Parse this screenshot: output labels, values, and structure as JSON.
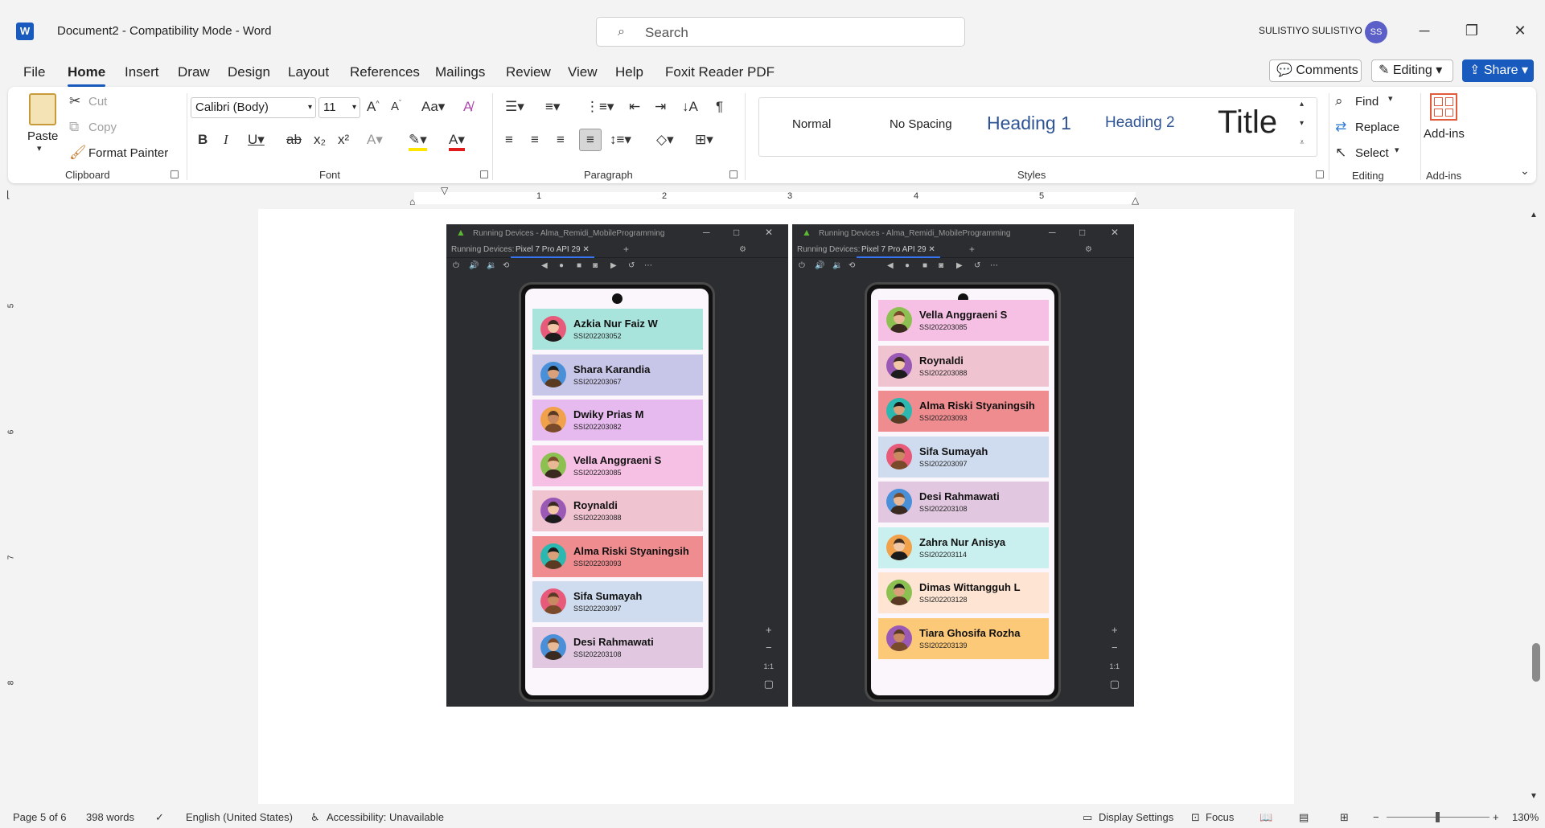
{
  "titlebar": {
    "app_icon": "word-logo-icon",
    "title": "Document2  -  Compatibility Mode  -  Word",
    "search_placeholder": "Search",
    "user": "SULISTIYO SULISTIYO",
    "avatar_initials": "SS"
  },
  "tabs": [
    "File",
    "Home",
    "Insert",
    "Draw",
    "Design",
    "Layout",
    "References",
    "Mailings",
    "Review",
    "View",
    "Help",
    "Foxit Reader PDF"
  ],
  "actions": {
    "comments": "Comments",
    "editing": "Editing",
    "share": "Share"
  },
  "clipboard": {
    "paste": "Paste",
    "cut": "Cut",
    "copy": "Copy",
    "format_painter": "Format Painter",
    "label": "Clipboard"
  },
  "font": {
    "name": "Calibri (Body)",
    "size": "11",
    "label": "Font"
  },
  "paragraph": {
    "label": "Paragraph"
  },
  "styles": {
    "items": [
      "Normal",
      "No Spacing",
      "Heading 1",
      "Heading 2",
      "Title"
    ],
    "label": "Styles"
  },
  "editing": {
    "find": "Find",
    "replace": "Replace",
    "select": "Select",
    "label": "Editing"
  },
  "addins": {
    "button": "Add-ins",
    "label": "Add-ins"
  },
  "ruler": {
    "numbers": [
      "1",
      "2",
      "3",
      "4",
      "5"
    ]
  },
  "vruler": {
    "numbers": [
      "5",
      "6",
      "7",
      "8"
    ]
  },
  "emulators": [
    {
      "title": "Running Devices - Alma_Remidi_MobileProgramming",
      "running_label": "Running Devices:",
      "device": "Pixel 7 Pro API 29",
      "cards": [
        {
          "name": "Azkia Nur Faiz W",
          "id": "SSI202203052",
          "color": "#a9e4dc"
        },
        {
          "name": "Shara Karandia",
          "id": "SSI202203067",
          "color": "#c7c5e8"
        },
        {
          "name": "Dwiky Prias M",
          "id": "SSI202203082",
          "color": "#e6baef"
        },
        {
          "name": "Vella Anggraeni S",
          "id": "SSI202203085",
          "color": "#f6bfe4"
        },
        {
          "name": "Roynaldi",
          "id": "SSI202203088",
          "color": "#efc3d0"
        },
        {
          "name": "Alma Riski Styaningsih",
          "id": "SSI202203093",
          "color": "#ef8c8f"
        },
        {
          "name": "Sifa Sumayah",
          "id": "SSI202203097",
          "color": "#cfdcef"
        },
        {
          "name": "Desi Rahmawati",
          "id": "SSI202203108",
          "color": "#e1c8e0"
        }
      ]
    },
    {
      "title": "Running Devices - Alma_Remidi_MobileProgramming",
      "running_label": "Running Devices:",
      "device": "Pixel 7 Pro API 29",
      "cards": [
        {
          "name": "Vella Anggraeni S",
          "id": "SSI202203085",
          "color": "#f6bfe4"
        },
        {
          "name": "Roynaldi",
          "id": "SSI202203088",
          "color": "#efc3d0"
        },
        {
          "name": "Alma Riski Styaningsih",
          "id": "SSI202203093",
          "color": "#ef8c8f"
        },
        {
          "name": "Sifa Sumayah",
          "id": "SSI202203097",
          "color": "#cfdcef"
        },
        {
          "name": "Desi Rahmawati",
          "id": "SSI202203108",
          "color": "#e1c8e0"
        },
        {
          "name": "Zahra Nur Anisya",
          "id": "SSI202203114",
          "color": "#c9f0ee"
        },
        {
          "name": "Dimas Wittangguh L",
          "id": "SSI202203128",
          "color": "#fde4d3"
        },
        {
          "name": "Tiara Ghosifa Rozha",
          "id": "SSI202203139",
          "color": "#fcc978"
        }
      ]
    }
  ],
  "status": {
    "page": "Page 5 of 6",
    "words": "398 words",
    "language": "English (United States)",
    "accessibility": "Accessibility: Unavailable",
    "display_settings": "Display Settings",
    "focus": "Focus",
    "zoom": "130%"
  }
}
